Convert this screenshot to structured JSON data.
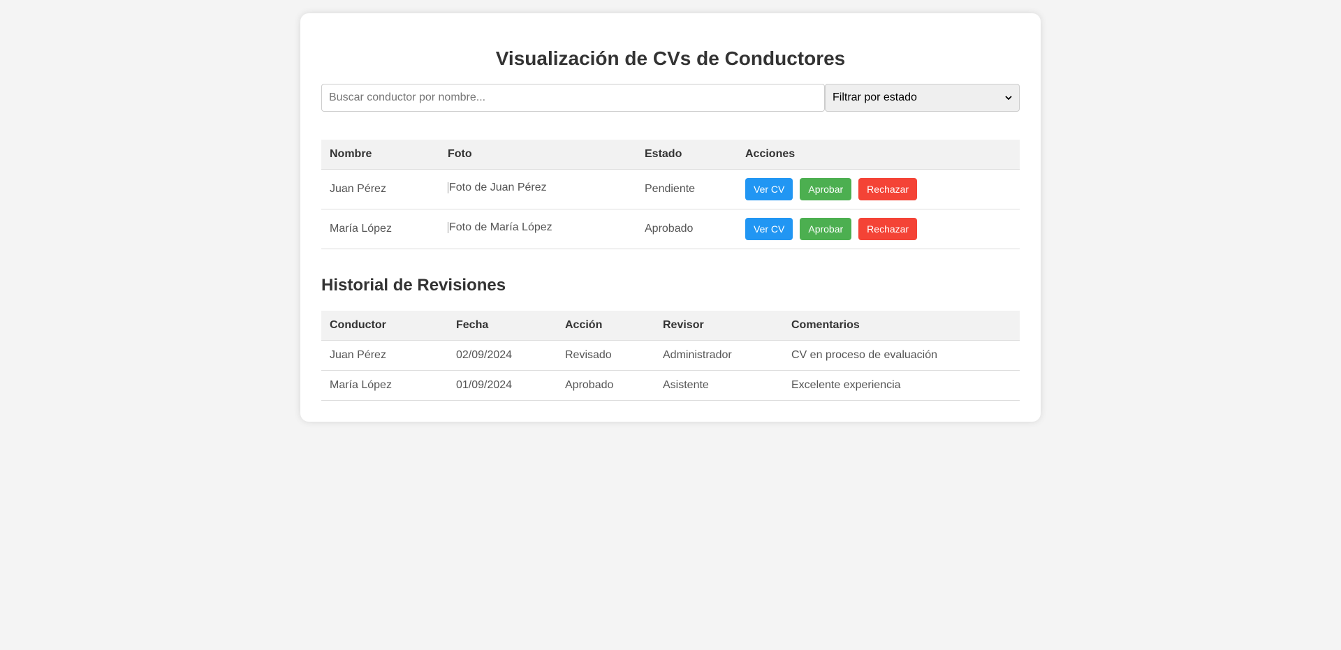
{
  "title": "Visualización de CVs de Conductores",
  "search": {
    "placeholder": "Buscar conductor por nombre..."
  },
  "filter": {
    "selected": "Filtrar por estado"
  },
  "drivers": {
    "headers": [
      "Nombre",
      "Foto",
      "Estado",
      "Acciones"
    ],
    "rows": [
      {
        "name": "Juan Pérez",
        "photo_alt": "Foto de Juan Pérez",
        "status": "Pendiente"
      },
      {
        "name": "María López",
        "photo_alt": "Foto de María López",
        "status": "Aprobado"
      }
    ],
    "actions": {
      "view": "Ver CV",
      "approve": "Aprobar",
      "reject": "Rechazar"
    }
  },
  "history": {
    "title": "Historial de Revisiones",
    "headers": [
      "Conductor",
      "Fecha",
      "Acción",
      "Revisor",
      "Comentarios"
    ],
    "rows": [
      {
        "driver": "Juan Pérez",
        "date": "02/09/2024",
        "action": "Revisado",
        "reviewer": "Administrador",
        "comments": "CV en proceso de evaluación"
      },
      {
        "driver": "María López",
        "date": "01/09/2024",
        "action": "Aprobado",
        "reviewer": "Asistente",
        "comments": "Excelente experiencia"
      }
    ]
  },
  "colors": {
    "view_button": "#2196f3",
    "approve_button": "#4caf50",
    "reject_button": "#f44336"
  }
}
